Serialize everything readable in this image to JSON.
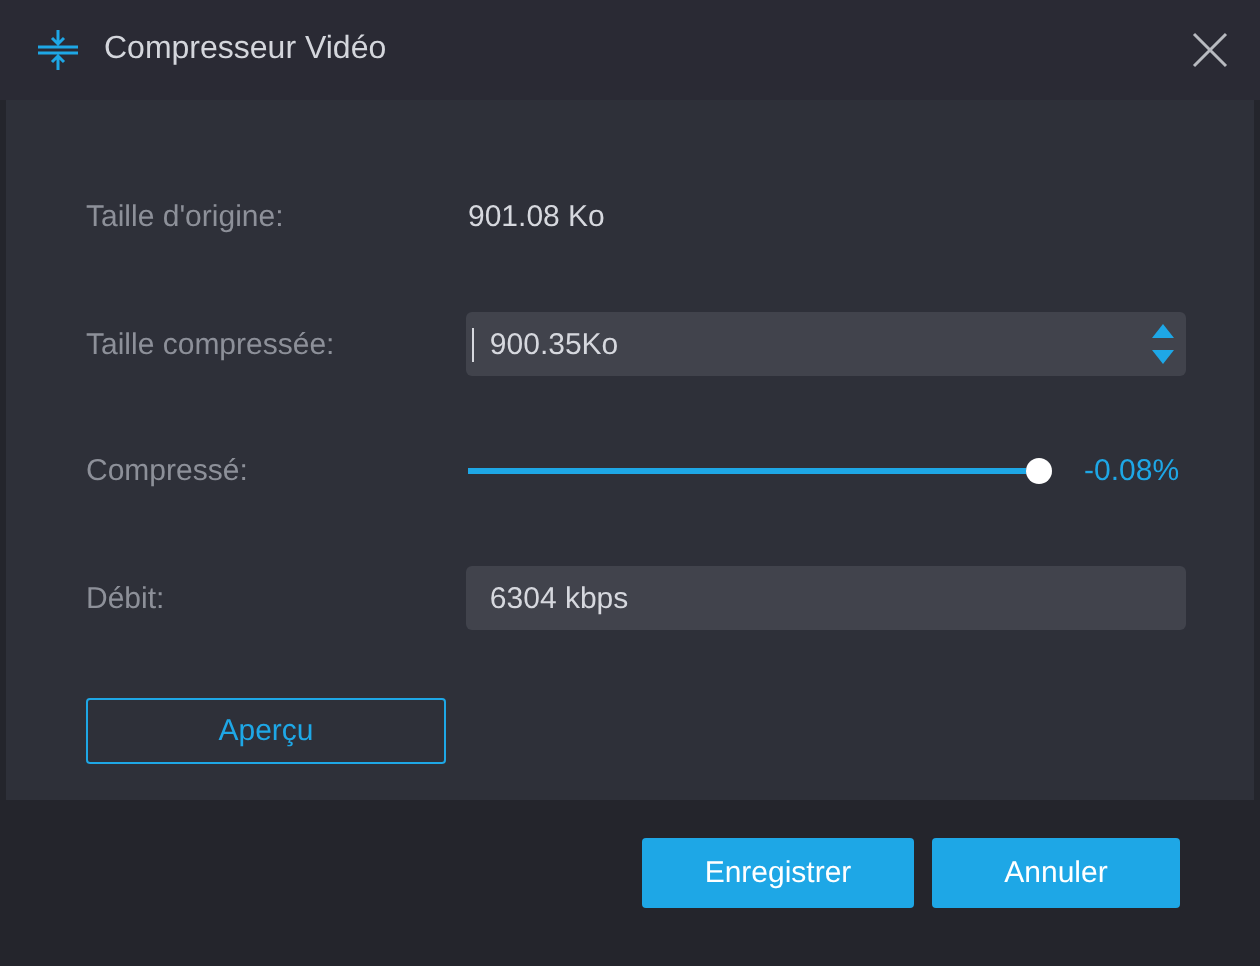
{
  "window": {
    "title": "Compresseur Vidéo"
  },
  "rows": [
    {
      "kind": "text",
      "label": "Taille d'origine:",
      "value": "901.08 Ko"
    },
    {
      "kind": "spin",
      "label": "Taille compressée:",
      "value": "900.35Ko"
    },
    {
      "kind": "slider",
      "label": "Compressé:",
      "level": 1,
      "reading": "-0.08%"
    },
    {
      "kind": "field",
      "label": "Débit:",
      "value": "6304 kbps"
    }
  ],
  "preview_button": "Aperçu",
  "buttons": [
    "Enregistrer",
    "Annuler"
  ]
}
